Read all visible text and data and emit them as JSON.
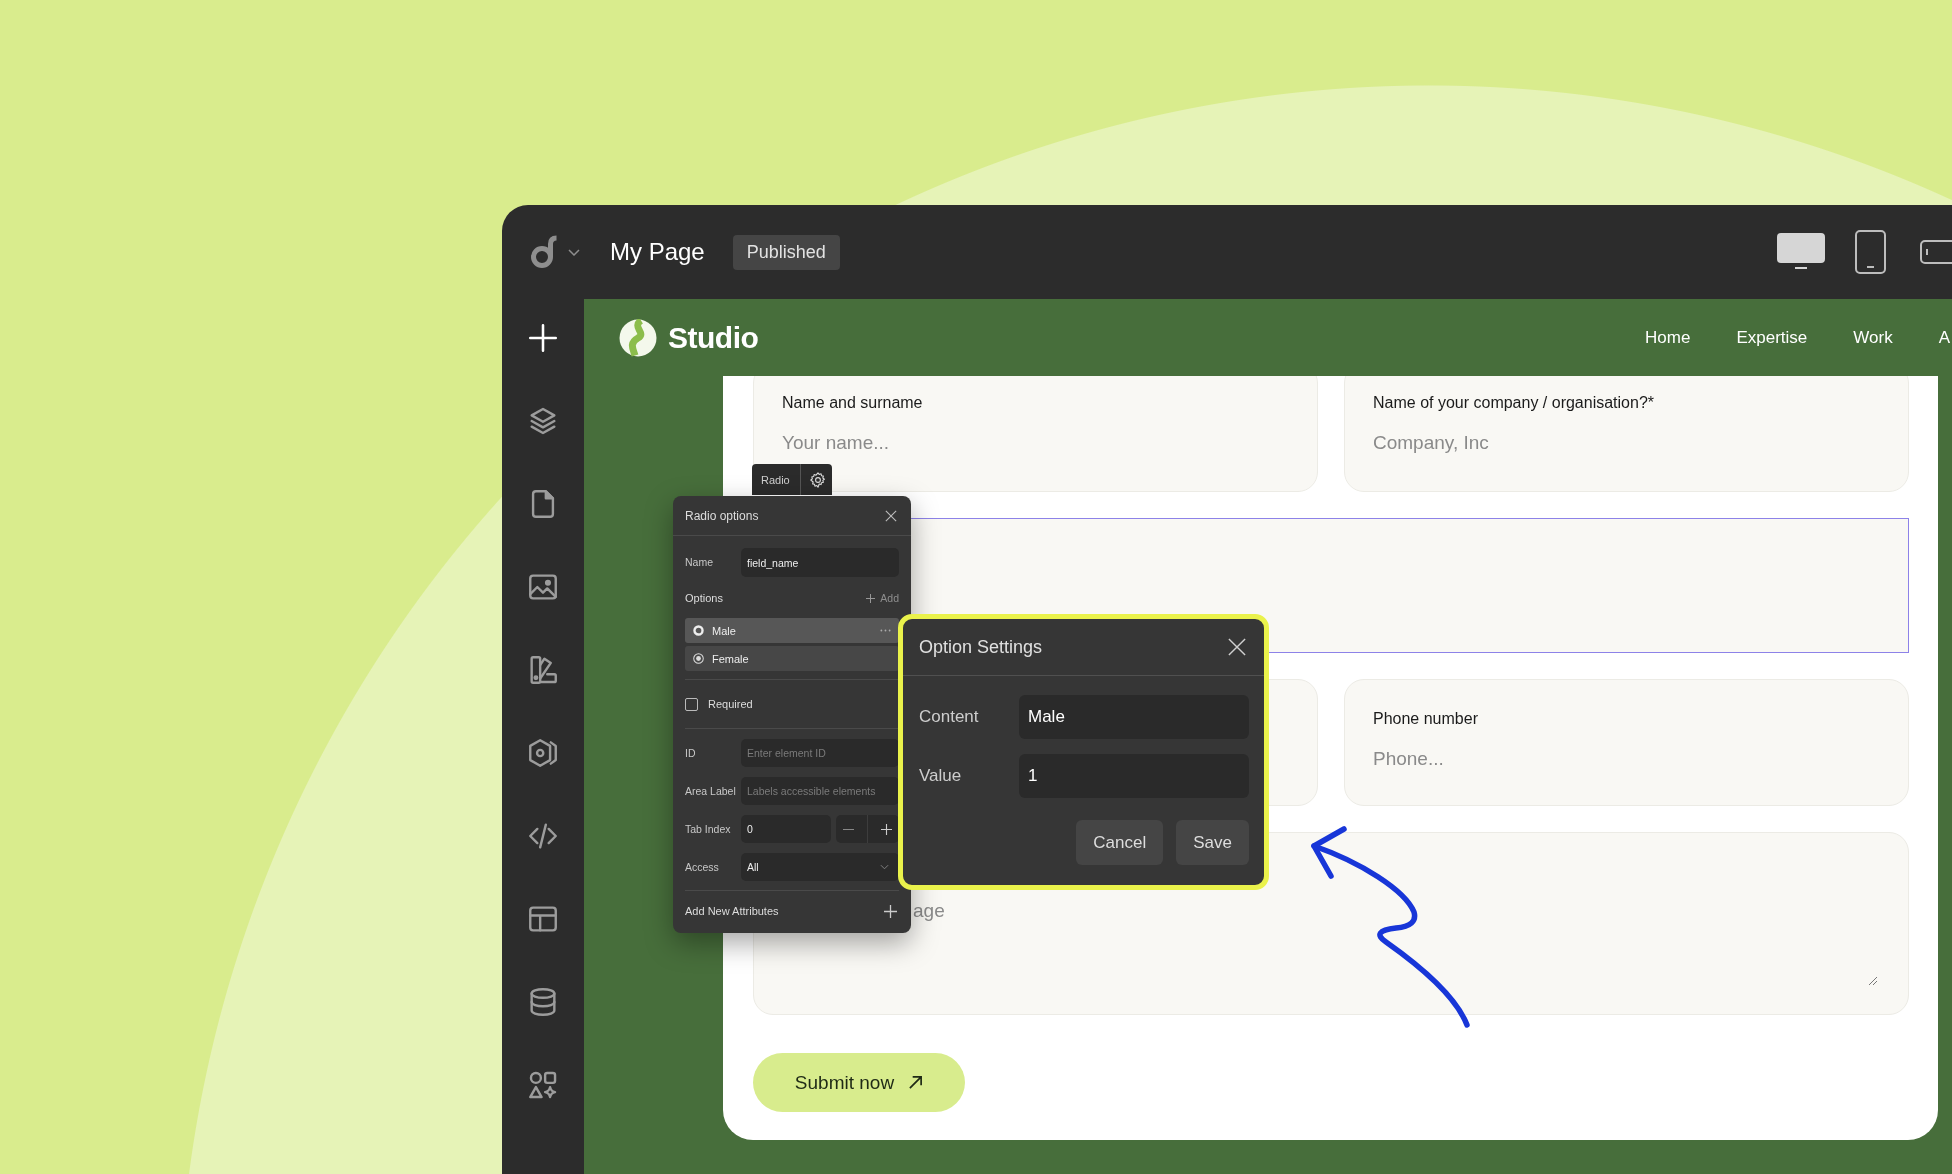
{
  "top_bar": {
    "page_title": "My Page",
    "status": "Published",
    "devices": [
      {
        "kind": "desktop",
        "selected": true
      },
      {
        "kind": "tablet",
        "selected": false
      },
      {
        "kind": "mobile",
        "selected": false
      }
    ]
  },
  "site_header": {
    "brand": "Studio",
    "nav": [
      {
        "label": "Home"
      },
      {
        "label": "Expertise"
      },
      {
        "label": "Work"
      },
      {
        "label": "A"
      }
    ]
  },
  "form": {
    "fields": [
      {
        "kind": "text",
        "selected": false,
        "label": "Name and surname",
        "placeholder": "Your name..."
      },
      {
        "kind": "text",
        "selected": false,
        "label": "Name of your company / organisation?*",
        "placeholder": "Company, Inc"
      },
      {
        "kind": "radio",
        "selected": true
      },
      {
        "kind": "text",
        "selected": false
      },
      {
        "kind": "text",
        "selected": false,
        "label": "Phone number",
        "placeholder": "Phone..."
      },
      {
        "kind": "textarea",
        "selected": false,
        "placeholder": "age"
      }
    ],
    "submit": "Submit now"
  },
  "element_tag": {
    "label": "Radio"
  },
  "radio_panel": {
    "title": "Radio options",
    "name": {
      "label": "Name",
      "value": "field_name"
    },
    "options_label": "Options",
    "add_label": "Add",
    "options": [
      {
        "label": "Male",
        "selected": true,
        "checked": false
      },
      {
        "label": "Female",
        "selected": false,
        "checked": true
      }
    ],
    "required": {
      "label": "Required",
      "checked": false
    },
    "element_id": {
      "label": "ID",
      "placeholder": "Enter element ID"
    },
    "area_label": {
      "label": "Area Label",
      "placeholder": "Labels accessible elements"
    },
    "tab_index": {
      "label": "Tab Index",
      "value": "0"
    },
    "access": {
      "label": "Access",
      "value": "All"
    },
    "add_attributes": "Add New Attributes"
  },
  "option_dialog": {
    "title": "Option Settings",
    "fields": [
      {
        "label": "Content",
        "value": "Male"
      },
      {
        "label": "Value",
        "value": "1"
      }
    ],
    "buttons": [
      {
        "label": "Cancel"
      },
      {
        "label": "Save"
      }
    ]
  }
}
